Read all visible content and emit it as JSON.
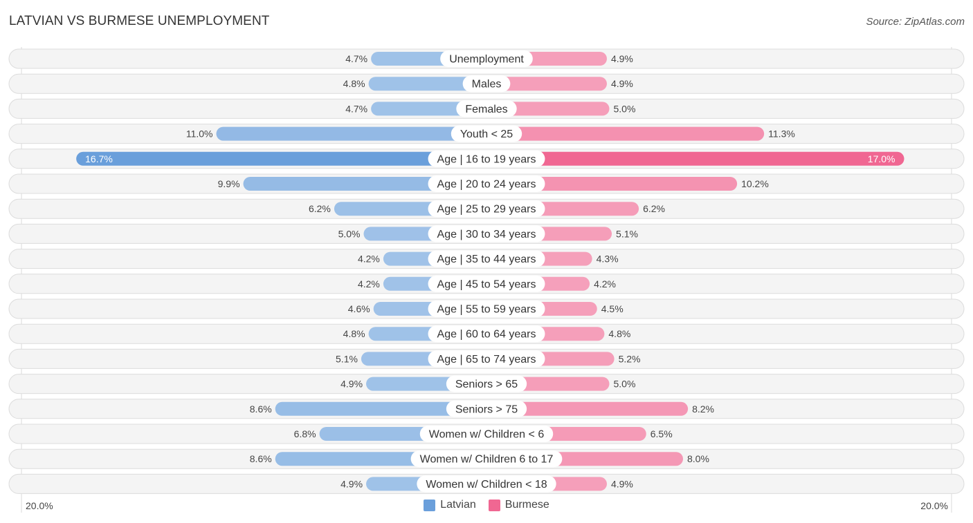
{
  "header": {
    "title": "LATVIAN VS BURMESE UNEMPLOYMENT",
    "source": "Source: ZipAtlas.com"
  },
  "chart_data": {
    "type": "bar",
    "orientation": "horizontal-diverging",
    "title": "LATVIAN VS BURMESE UNEMPLOYMENT",
    "xlabel": "",
    "ylabel": "",
    "xlim": [
      -20.0,
      20.0
    ],
    "axis_labels": {
      "left": "20.0%",
      "right": "20.0%"
    },
    "value_suffix": "%",
    "legend_position": "bottom-center",
    "grid": false,
    "categories": [
      "Unemployment",
      "Males",
      "Females",
      "Youth < 25",
      "Age | 16 to 19 years",
      "Age | 20 to 24 years",
      "Age | 25 to 29 years",
      "Age | 30 to 34 years",
      "Age | 35 to 44 years",
      "Age | 45 to 54 years",
      "Age | 55 to 59 years",
      "Age | 60 to 64 years",
      "Age | 65 to 74 years",
      "Seniors > 65",
      "Seniors > 75",
      "Women w/ Children < 6",
      "Women w/ Children 6 to 17",
      "Women w/ Children < 18"
    ],
    "series": [
      {
        "name": "Latvian",
        "side": "left",
        "color": "#6a9fdb",
        "color_light": "#a9c8ea",
        "values": [
          4.7,
          4.8,
          4.7,
          11.0,
          16.7,
          9.9,
          6.2,
          5.0,
          4.2,
          4.2,
          4.6,
          4.8,
          5.1,
          4.9,
          8.6,
          6.8,
          8.6,
          4.9
        ],
        "labels": [
          "4.7%",
          "4.8%",
          "4.7%",
          "11.0%",
          "16.7%",
          "9.9%",
          "6.2%",
          "5.0%",
          "4.2%",
          "4.2%",
          "4.6%",
          "4.8%",
          "5.1%",
          "4.9%",
          "8.6%",
          "6.8%",
          "8.6%",
          "4.9%"
        ]
      },
      {
        "name": "Burmese",
        "side": "right",
        "color": "#f06792",
        "color_light": "#f6a9c1",
        "values": [
          4.9,
          4.9,
          5.0,
          11.3,
          17.0,
          10.2,
          6.2,
          5.1,
          4.3,
          4.2,
          4.5,
          4.8,
          5.2,
          5.0,
          8.2,
          6.5,
          8.0,
          4.9
        ],
        "labels": [
          "4.9%",
          "4.9%",
          "5.0%",
          "11.3%",
          "17.0%",
          "10.2%",
          "6.2%",
          "5.1%",
          "4.3%",
          "4.2%",
          "4.5%",
          "4.8%",
          "5.2%",
          "5.0%",
          "8.2%",
          "6.5%",
          "8.0%",
          "4.9%"
        ]
      }
    ],
    "highlighted_row": "Age | 16 to 19 years"
  },
  "legend": {
    "items": [
      {
        "label": "Latvian",
        "color": "#6a9fdb"
      },
      {
        "label": "Burmese",
        "color": "#f06792"
      }
    ]
  }
}
